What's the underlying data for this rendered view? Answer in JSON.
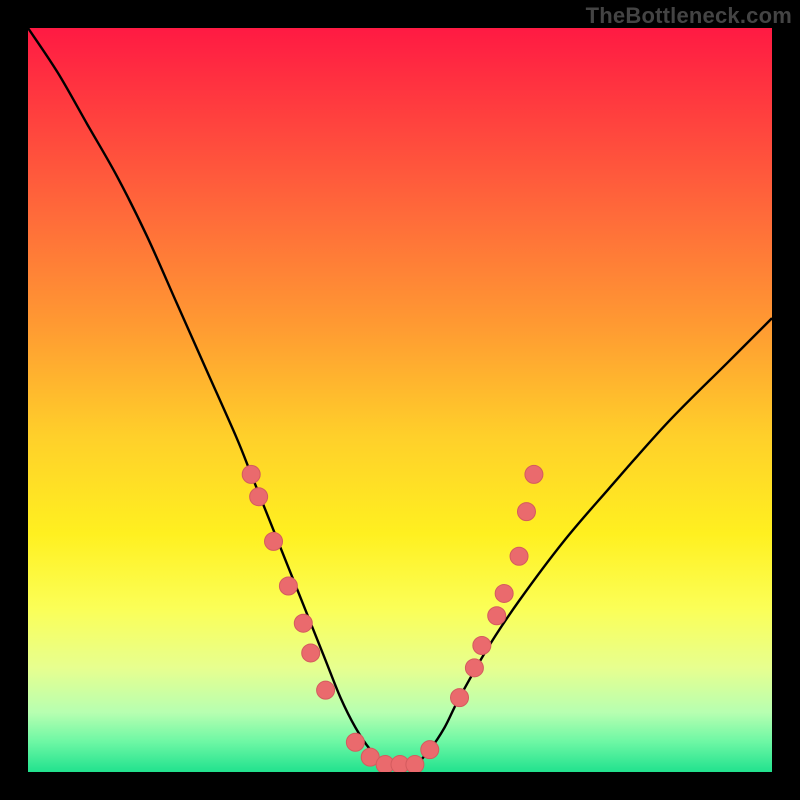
{
  "watermark": "TheBottleneck.com",
  "colors": {
    "frame": "#000000",
    "curve": "#000000",
    "marker_fill": "#ea6a6d",
    "marker_stroke": "#d45b5e",
    "gradient_stops": [
      {
        "offset": 0.0,
        "color": "#ff1a43"
      },
      {
        "offset": 0.1,
        "color": "#ff3a3f"
      },
      {
        "offset": 0.25,
        "color": "#ff6a3a"
      },
      {
        "offset": 0.4,
        "color": "#ff9a32"
      },
      {
        "offset": 0.55,
        "color": "#ffd02a"
      },
      {
        "offset": 0.68,
        "color": "#fff020"
      },
      {
        "offset": 0.78,
        "color": "#fbff57"
      },
      {
        "offset": 0.86,
        "color": "#e7ff8f"
      },
      {
        "offset": 0.92,
        "color": "#b7ffb1"
      },
      {
        "offset": 0.96,
        "color": "#6cf7a4"
      },
      {
        "offset": 1.0,
        "color": "#21e28e"
      }
    ]
  },
  "chart_data": {
    "type": "line",
    "title": "",
    "xlabel": "",
    "ylabel": "",
    "xlim": [
      0,
      100
    ],
    "ylim": [
      0,
      100
    ],
    "series": [
      {
        "name": "bottleneck-curve",
        "x": [
          0,
          4,
          8,
          12,
          16,
          20,
          24,
          28,
          30,
          32,
          34,
          36,
          38,
          40,
          42,
          44,
          46,
          48,
          50,
          52,
          54,
          56,
          58,
          62,
          66,
          72,
          78,
          86,
          94,
          100
        ],
        "y": [
          100,
          94,
          87,
          80,
          72,
          63,
          54,
          45,
          40,
          35,
          30,
          25,
          20,
          15,
          10,
          6,
          3,
          1,
          1,
          1,
          3,
          6,
          10,
          17,
          23,
          31,
          38,
          47,
          55,
          61
        ]
      }
    ],
    "markers": {
      "name": "highlight-points",
      "points": [
        {
          "x": 30,
          "y": 40
        },
        {
          "x": 31,
          "y": 37
        },
        {
          "x": 33,
          "y": 31
        },
        {
          "x": 35,
          "y": 25
        },
        {
          "x": 37,
          "y": 20
        },
        {
          "x": 38,
          "y": 16
        },
        {
          "x": 40,
          "y": 11
        },
        {
          "x": 44,
          "y": 4
        },
        {
          "x": 46,
          "y": 2
        },
        {
          "x": 48,
          "y": 1
        },
        {
          "x": 50,
          "y": 1
        },
        {
          "x": 52,
          "y": 1
        },
        {
          "x": 54,
          "y": 3
        },
        {
          "x": 58,
          "y": 10
        },
        {
          "x": 60,
          "y": 14
        },
        {
          "x": 61,
          "y": 17
        },
        {
          "x": 63,
          "y": 21
        },
        {
          "x": 64,
          "y": 24
        },
        {
          "x": 66,
          "y": 29
        },
        {
          "x": 67,
          "y": 35
        },
        {
          "x": 68,
          "y": 40
        }
      ]
    }
  }
}
